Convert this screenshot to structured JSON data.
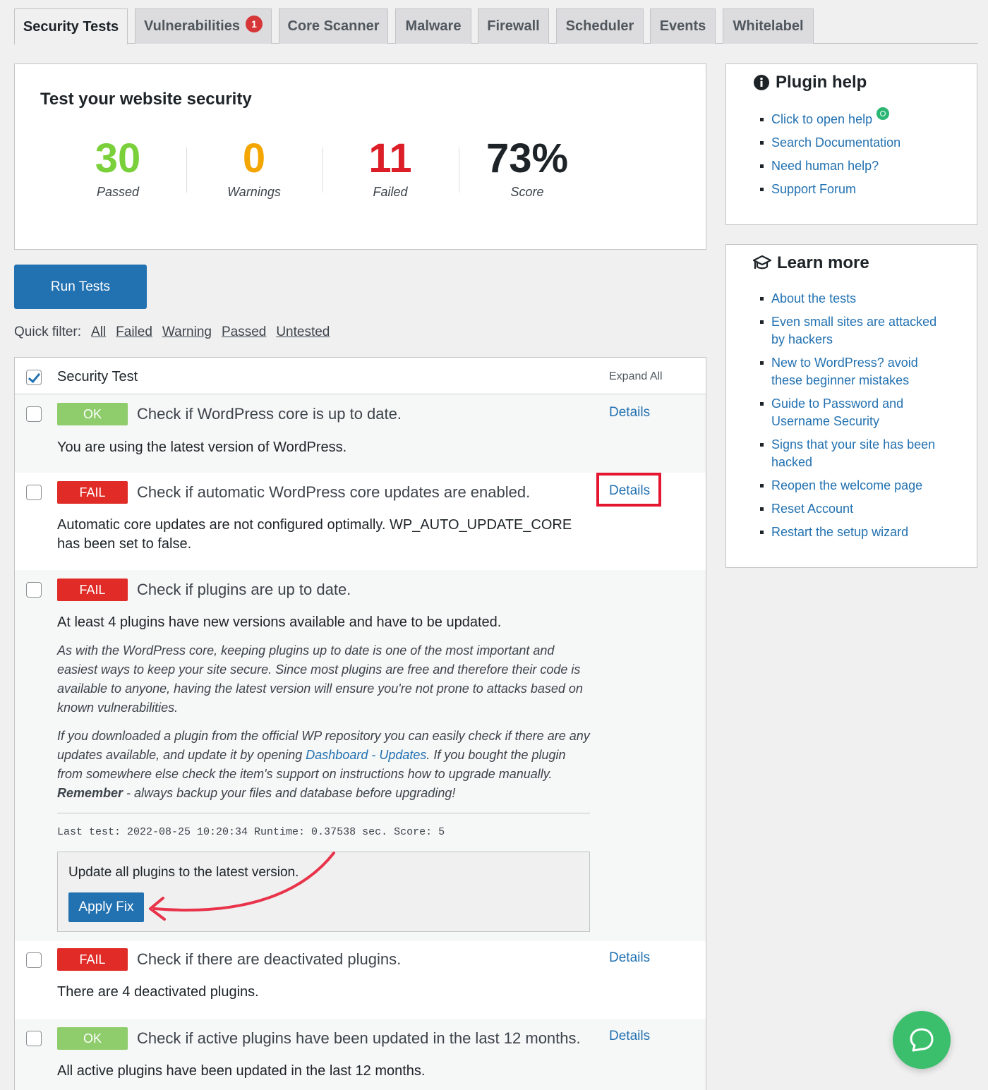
{
  "tabs": [
    {
      "label": "Security Tests"
    },
    {
      "label": "Vulnerabilities",
      "badge": "1"
    },
    {
      "label": "Core Scanner"
    },
    {
      "label": "Malware"
    },
    {
      "label": "Firewall"
    },
    {
      "label": "Scheduler"
    },
    {
      "label": "Events"
    },
    {
      "label": "Whitelabel"
    }
  ],
  "summary": {
    "title": "Test your website security",
    "passed": {
      "value": "30",
      "label": "Passed",
      "color": "#7ad03a"
    },
    "warnings": {
      "value": "0",
      "label": "Warnings",
      "color": "#f3a500"
    },
    "failed": {
      "value": "11",
      "label": "Failed",
      "color": "#dc1e28"
    },
    "score": {
      "value": "73%",
      "label": "Score",
      "color": "#1d2327"
    }
  },
  "run_button": "Run Tests",
  "quick_filter": {
    "label": "Quick filter:",
    "options": [
      "All",
      "Failed",
      "Warning",
      "Passed",
      "Untested"
    ]
  },
  "table": {
    "header": "Security Test",
    "expand_all": "Expand All",
    "rows": [
      {
        "status": "OK",
        "name": "Check if WordPress core is up to date.",
        "details": "Details",
        "message": "You are using the latest version of WordPress."
      },
      {
        "status": "FAIL",
        "name": "Check if automatic WordPress core updates are enabled.",
        "details": "Details",
        "message_line1": "Automatic core updates are not configured optimally. WP_AUTO_UPDATE_CORE",
        "message_line2": "has been set to false."
      },
      {
        "status": "FAIL",
        "name": "Check if plugins are up to date.",
        "message": "At least 4 plugins have new versions available and have to be updated.",
        "desc1": "As with the WordPress core, keeping plugins up to date is one of the most important and easiest ways to keep your site secure. Since most plugins are free and therefore their code is available to anyone, having the latest version will ensure you're not prone to attacks based on known vulnerabilities.",
        "desc2_a": "If you downloaded a plugin from the official WP repository you can easily check if there are any updates available, and update it by opening ",
        "desc2_link": "Dashboard - Updates",
        "desc2_b": ". If you bought the plugin from somewhere else check the item's support on instructions how to upgrade manually. ",
        "desc2_bold": "Remember",
        "desc2_c": " - always backup your files and database before upgrading!",
        "last_test": "Last test: 2022-08-25 10:20:34 Runtime: 0.37538 sec. Score: 5",
        "fix_text": "Update all plugins to the latest version.",
        "fix_button": "Apply Fix"
      },
      {
        "status": "FAIL",
        "name": "Check if there are deactivated plugins.",
        "details": "Details",
        "message": "There are 4 deactivated plugins."
      },
      {
        "status": "OK",
        "name": "Check if active plugins have been updated in the last 12 months.",
        "details": "Details",
        "message": "All active plugins have been updated in the last 12 months."
      }
    ]
  },
  "plugin_help": {
    "title": "Plugin help",
    "items": [
      "Click to open help",
      "Search Documentation",
      "Need human help?",
      "Support Forum"
    ]
  },
  "learn_more": {
    "title": "Learn more",
    "items": [
      "About the tests",
      "Even small sites are attacked by hackers",
      "New to WordPress? avoid these beginner mistakes",
      "Guide to Password and Username Security",
      "Signs that your site has been hacked",
      "Reopen the welcome page",
      "Reset Account",
      "Restart the setup wizard"
    ]
  },
  "colors": {
    "accent": "#2271b1",
    "ok": "#8fcc6b",
    "fail": "#e02b27",
    "highlight": "#e5162f",
    "chat": "#3bbf6d"
  },
  "icons": {
    "plugin_help": "info-circle-icon",
    "learn_more": "graduation-cap-icon",
    "chat": "chat-bubble-icon"
  }
}
